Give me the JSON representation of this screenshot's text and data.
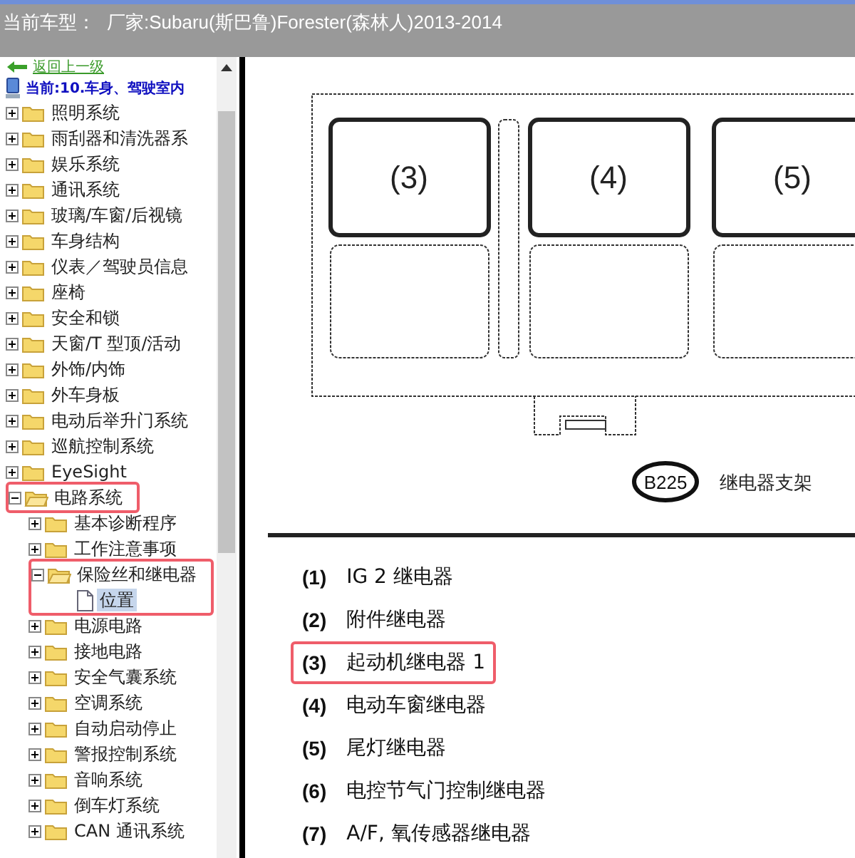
{
  "title_bar": {
    "label": "当前车型：",
    "value": "厂家:Subaru(斯巴鲁)Forester(森林人)2013-2014"
  },
  "sidebar": {
    "back_link": "返回上一级",
    "current": "当前:10.车身、驾驶室内",
    "tree": [
      {
        "label": "照明系统",
        "kind": "folder",
        "expanded": false,
        "selected": false,
        "highlighted": false
      },
      {
        "label": "雨刮器和清洗器系",
        "kind": "folder",
        "expanded": false,
        "selected": false,
        "highlighted": false
      },
      {
        "label": "娱乐系统",
        "kind": "folder",
        "expanded": false,
        "selected": false,
        "highlighted": false
      },
      {
        "label": "通讯系统",
        "kind": "folder",
        "expanded": false,
        "selected": false,
        "highlighted": false
      },
      {
        "label": "玻璃/车窗/后视镜",
        "kind": "folder",
        "expanded": false,
        "selected": false,
        "highlighted": false
      },
      {
        "label": "车身结构",
        "kind": "folder",
        "expanded": false,
        "selected": false,
        "highlighted": false
      },
      {
        "label": "仪表／驾驶员信息",
        "kind": "folder",
        "expanded": false,
        "selected": false,
        "highlighted": false
      },
      {
        "label": "座椅",
        "kind": "folder",
        "expanded": false,
        "selected": false,
        "highlighted": false
      },
      {
        "label": "安全和锁",
        "kind": "folder",
        "expanded": false,
        "selected": false,
        "highlighted": false
      },
      {
        "label": "天窗/T 型顶/活动",
        "kind": "folder",
        "expanded": false,
        "selected": false,
        "highlighted": false
      },
      {
        "label": "外饰/内饰",
        "kind": "folder",
        "expanded": false,
        "selected": false,
        "highlighted": false
      },
      {
        "label": "外车身板",
        "kind": "folder",
        "expanded": false,
        "selected": false,
        "highlighted": false
      },
      {
        "label": "电动后举升门系统",
        "kind": "folder",
        "expanded": false,
        "selected": false,
        "highlighted": false
      },
      {
        "label": "巡航控制系统",
        "kind": "folder",
        "expanded": false,
        "selected": false,
        "highlighted": false
      },
      {
        "label": "EyeSight",
        "kind": "folder",
        "expanded": false,
        "selected": false,
        "highlighted": false
      },
      {
        "label": "电路系统",
        "kind": "folder",
        "expanded": true,
        "selected": false,
        "highlighted": true,
        "children": [
          {
            "label": "基本诊断程序",
            "kind": "folder",
            "expanded": false,
            "selected": false,
            "highlighted": false
          },
          {
            "label": "工作注意事项",
            "kind": "folder",
            "expanded": false,
            "selected": false,
            "highlighted": false
          },
          {
            "label": "保险丝和继电器",
            "kind": "folder",
            "expanded": true,
            "selected": false,
            "highlighted": true,
            "children": [
              {
                "label": "位置",
                "kind": "page",
                "expanded": false,
                "selected": true,
                "highlighted": true
              }
            ]
          },
          {
            "label": "电源电路",
            "kind": "folder",
            "expanded": false,
            "selected": false,
            "highlighted": false
          },
          {
            "label": "接地电路",
            "kind": "folder",
            "expanded": false,
            "selected": false,
            "highlighted": false
          },
          {
            "label": "安全气囊系统",
            "kind": "folder",
            "expanded": false,
            "selected": false,
            "highlighted": false
          },
          {
            "label": "空调系统",
            "kind": "folder",
            "expanded": false,
            "selected": false,
            "highlighted": false
          },
          {
            "label": "自动启动停止",
            "kind": "folder",
            "expanded": false,
            "selected": false,
            "highlighted": false
          },
          {
            "label": "警报控制系统",
            "kind": "folder",
            "expanded": false,
            "selected": false,
            "highlighted": false
          },
          {
            "label": "音响系统",
            "kind": "folder",
            "expanded": false,
            "selected": false,
            "highlighted": false
          },
          {
            "label": "倒车灯系统",
            "kind": "folder",
            "expanded": false,
            "selected": false,
            "highlighted": false
          },
          {
            "label": "CAN 通讯系统",
            "kind": "folder",
            "expanded": false,
            "selected": false,
            "highlighted": false
          }
        ]
      }
    ]
  },
  "diagram": {
    "slots": [
      "(3)",
      "(4)",
      "(5)"
    ],
    "connector": "B225",
    "caption": "继电器支架"
  },
  "legend": [
    {
      "number": "(1)",
      "label": "IG 2 继电器",
      "highlighted": false
    },
    {
      "number": "(2)",
      "label": "附件继电器",
      "highlighted": false
    },
    {
      "number": "(3)",
      "label": "起动机继电器 1",
      "highlighted": true
    },
    {
      "number": "(4)",
      "label": "电动车窗继电器",
      "highlighted": false
    },
    {
      "number": "(5)",
      "label": "尾灯继电器",
      "highlighted": false
    },
    {
      "number": "(6)",
      "label": "电控节气门控制继电器",
      "highlighted": false
    },
    {
      "number": "(7)",
      "label": "A/F, 氧传感器继电器",
      "highlighted": false
    }
  ]
}
